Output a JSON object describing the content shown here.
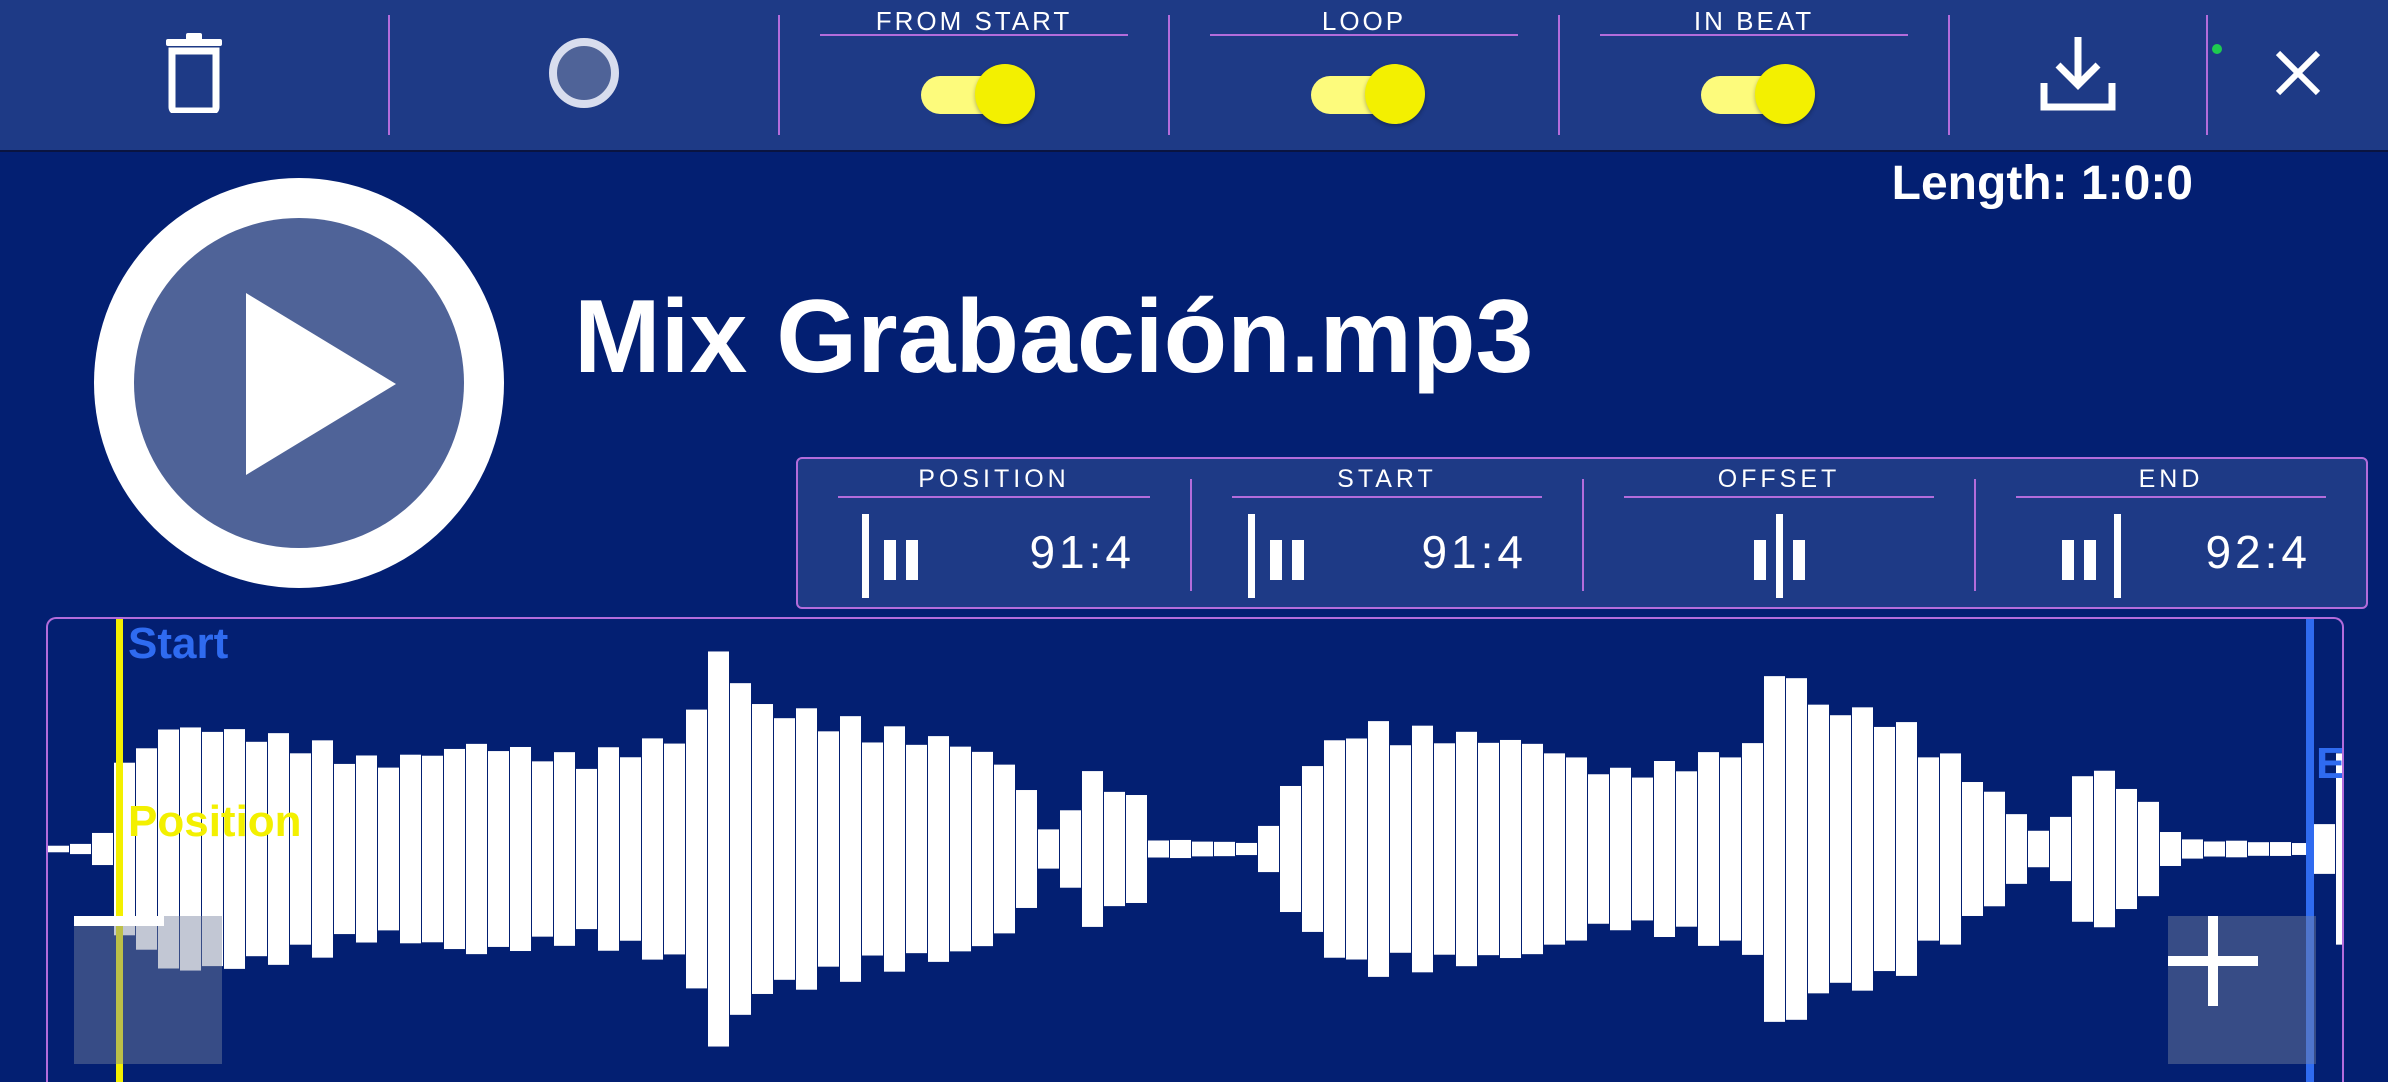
{
  "toolbar": {
    "delete_icon": "trash-icon",
    "record_icon": "record-circle-icon",
    "toggles": [
      {
        "label": "FROM START",
        "state": "on"
      },
      {
        "label": "LOOP",
        "state": "on"
      },
      {
        "label": "IN BEAT",
        "state": "on"
      }
    ],
    "download_icon": "download-icon",
    "close_icon": "close-icon"
  },
  "track": {
    "length": "Length: 1:0:0",
    "title": "Mix Grabación.mp3",
    "play_icon": "play-icon"
  },
  "markers": [
    {
      "label": "POSITION",
      "value": "91:4"
    },
    {
      "label": "START",
      "value": "91:4"
    },
    {
      "label": "OFFSET",
      "value": ""
    },
    {
      "label": "END",
      "value": "92:4"
    }
  ],
  "waveform": {
    "start_label": "Start",
    "position_label": "Position",
    "end_label": "E",
    "zoom_out_icon": "minus-icon",
    "zoom_in_icon": "plus-icon"
  },
  "colors": {
    "background": "#031f72",
    "toolbar": "#1e3a86",
    "accent_line": "#b36cdb",
    "toggle_on": "#f3f000",
    "start_marker": "#2f6bf0",
    "position_marker": "#f3f000",
    "waveform": "#ffffff"
  }
}
